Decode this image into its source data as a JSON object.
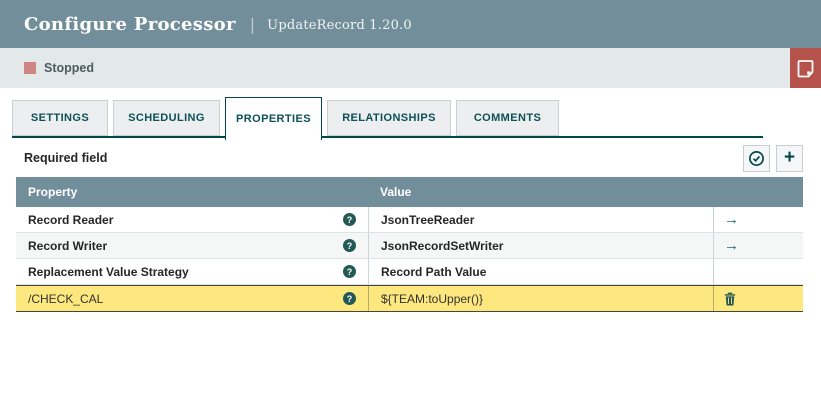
{
  "header": {
    "title": "Configure Processor",
    "divider": "|",
    "processor": "UpdateRecord 1.20.0"
  },
  "status": {
    "label": "Stopped"
  },
  "tabs": {
    "active": "PROPERTIES",
    "items": [
      {
        "label": "SETTINGS"
      },
      {
        "label": "SCHEDULING"
      },
      {
        "label": "PROPERTIES"
      },
      {
        "label": "RELATIONSHIPS"
      },
      {
        "label": "COMMENTS"
      }
    ]
  },
  "toolbar": {
    "required_label": "Required field"
  },
  "icons": {
    "question_glyph": "?",
    "arrow_glyph": "→",
    "plus_glyph": "+"
  },
  "table": {
    "headers": {
      "property": "Property",
      "value": "Value"
    },
    "rows": [
      {
        "property": "Record Reader",
        "value": "JsonTreeReader",
        "action": "go-to-service",
        "highlighted": false
      },
      {
        "property": "Record Writer",
        "value": "JsonRecordSetWriter",
        "action": "go-to-service",
        "highlighted": false
      },
      {
        "property": "Replacement Value Strategy",
        "value": "Record Path Value",
        "action": "none",
        "highlighted": false
      },
      {
        "property": "/CHECK_CAL",
        "value": "${TEAM:toUpper()}",
        "action": "delete",
        "highlighted": true
      }
    ]
  },
  "colors": {
    "header_bg": "#728e9b",
    "status_bar_bg": "#e3e8ea",
    "stopped_square": "#ce8683",
    "bulletin_bg": "#b5524c",
    "accent_teal": "#004849",
    "table_header_bg": "#728e9b",
    "highlight_row": "#fce87e"
  }
}
